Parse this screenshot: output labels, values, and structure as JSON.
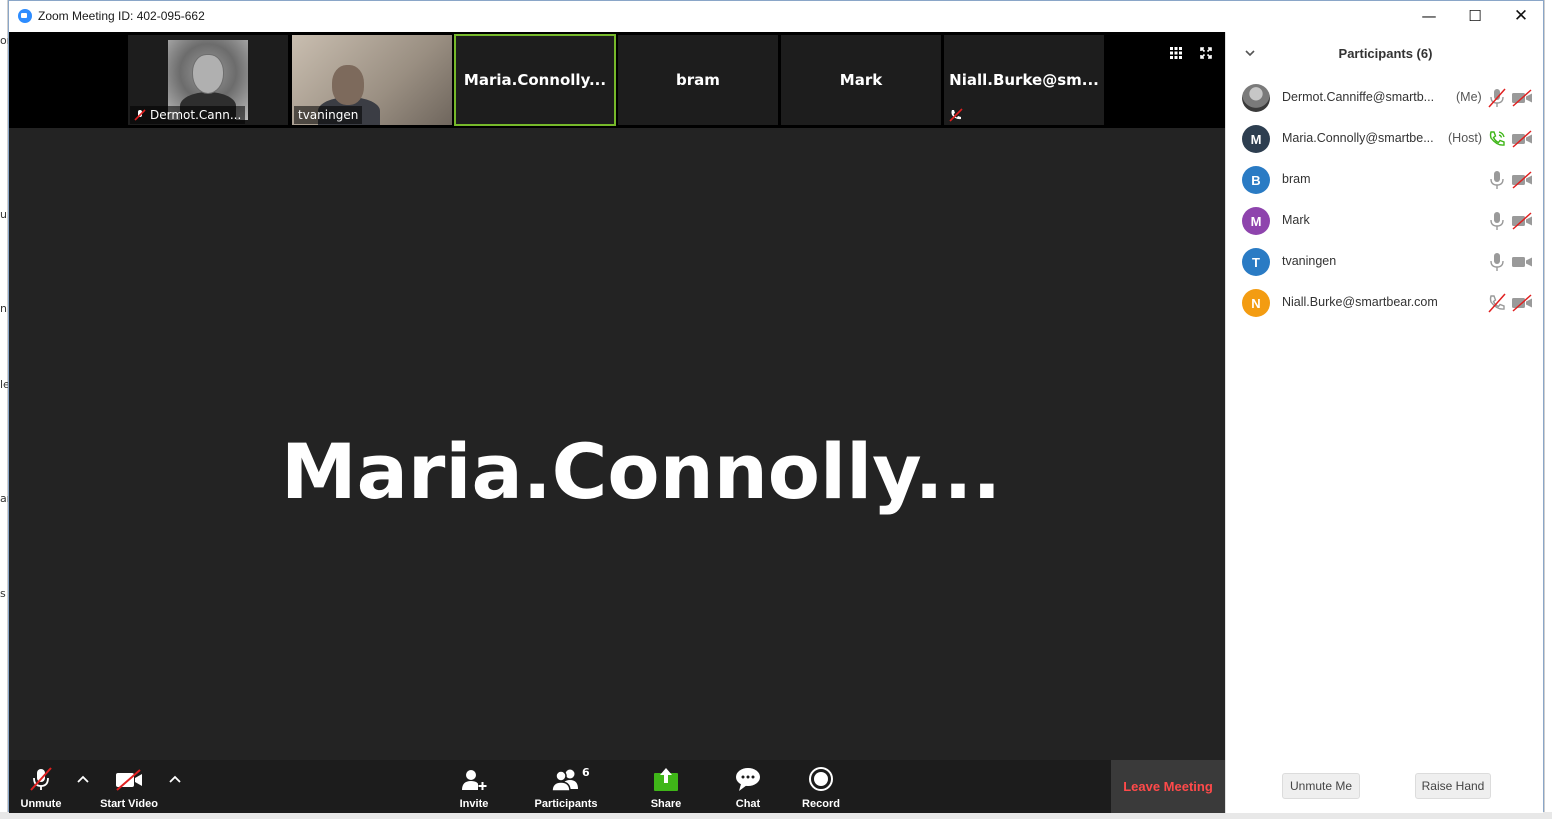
{
  "window": {
    "title": "Zoom Meeting ID: 402-095-662",
    "minimize_glyph": "—",
    "maximize_glyph": "☐",
    "close_glyph": "✕"
  },
  "thumbnails": [
    {
      "label": "Dermot.Cann...",
      "type": "video",
      "mic_muted": true
    },
    {
      "label": "tvaningen",
      "type": "video",
      "mic_muted": false
    },
    {
      "label": "Maria.Connolly...",
      "type": "name",
      "active": true
    },
    {
      "label": "bram",
      "type": "name"
    },
    {
      "label": "Mark",
      "type": "name"
    },
    {
      "label": "Niall.Burke@sm...",
      "type": "name",
      "phone_muted": true
    }
  ],
  "active_speaker": "Maria.Connolly...",
  "toolbar": {
    "unmute": "Unmute",
    "start_video": "Start Video",
    "invite": "Invite",
    "participants": "Participants",
    "participants_count": "6",
    "share": "Share",
    "chat": "Chat",
    "record": "Record",
    "leave": "Leave Meeting"
  },
  "panel": {
    "title": "Participants (6)",
    "participants": [
      {
        "initial": "",
        "name": "Dermot.Canniffe@smartb...",
        "role": "(Me)",
        "avatar_color": "photo",
        "audio": "muted",
        "video": "off"
      },
      {
        "initial": "M",
        "name": "Maria.Connolly@smartbe...",
        "role": "(Host)",
        "avatar_color": "#2d3e50",
        "audio": "phone",
        "video": "off"
      },
      {
        "initial": "B",
        "name": "bram",
        "role": "",
        "avatar_color": "#2a7bc4",
        "audio": "mic",
        "video": "off"
      },
      {
        "initial": "M",
        "name": "Mark",
        "role": "",
        "avatar_color": "#8e44ad",
        "audio": "mic",
        "video": "off"
      },
      {
        "initial": "T",
        "name": "tvaningen",
        "role": "",
        "avatar_color": "#2a7bc4",
        "audio": "mic",
        "video": "on"
      },
      {
        "initial": "N",
        "name": "Niall.Burke@smartbear.com",
        "role": "",
        "avatar_color": "#f39c12",
        "audio": "phone-muted",
        "video": "off"
      }
    ],
    "unmute_me": "Unmute Me",
    "raise_hand": "Raise Hand"
  },
  "desktop_fragments": [
    "or",
    "u",
    "n",
    "le",
    "ar",
    "s"
  ],
  "colors": {
    "accent_active": "#76b82a",
    "leave_red": "#ff4a4a",
    "muted_red": "#e02020",
    "share_green": "#3fb618",
    "zoom_blue": "#2d8cff"
  }
}
